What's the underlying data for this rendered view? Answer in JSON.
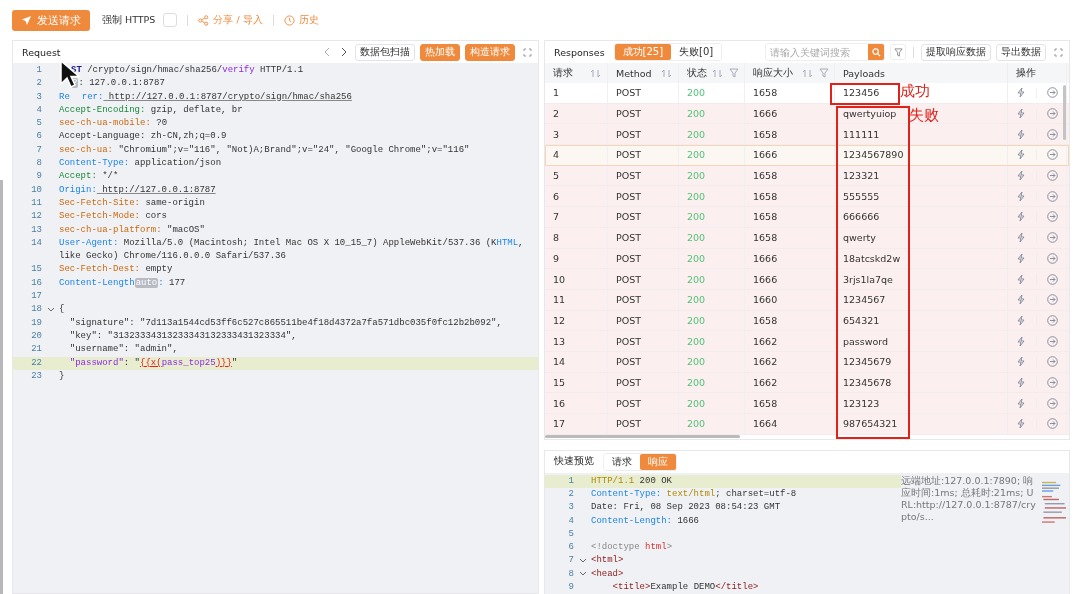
{
  "toolbar": {
    "send_button": "发送请求",
    "force_https": {
      "label": "强制 HTTPS",
      "checked": false
    },
    "share_link": "分享 / 导入",
    "history_link": "历史"
  },
  "request": {
    "title": "Request",
    "buttons": [
      {
        "label": "数据包扫描",
        "primary": false
      },
      {
        "label": "热加载",
        "primary": true
      },
      {
        "label": "构造请求",
        "primary": true
      }
    ],
    "lines": [
      {
        "n": "1",
        "tokens": [
          {
            "t": "ST",
            "kind": "method",
            "covered_before": true
          },
          {
            "t": " /crypto/sign/hmac/sha256/"
          },
          {
            "t": "verify",
            "kind": "purple"
          },
          {
            "t": " HTTP/1.1"
          }
        ]
      },
      {
        "n": "2",
        "tokens": [
          {
            "t": "?",
            "kind": "badge",
            "covered_before": true
          },
          {
            "t": ": 127.0.0.1:8787"
          }
        ]
      },
      {
        "n": "3",
        "tokens": [
          {
            "t": "Re",
            "kind": "blue"
          },
          {
            "t": "rer:",
            "kind": "blue",
            "covered_before": true
          },
          {
            "t": " http://127.0.0.1:8787/crypto/sign/hmac/sha256",
            "kind": "url"
          }
        ]
      },
      {
        "n": "4",
        "tokens": [
          {
            "t": "Accept-Encoding:",
            "kind": "green"
          },
          {
            "t": " gzip, deflate, br"
          }
        ]
      },
      {
        "n": "5",
        "tokens": [
          {
            "t": "sec-ch-ua-mobile:",
            "kind": "orange"
          },
          {
            "t": " ?0"
          }
        ]
      },
      {
        "n": "6",
        "tokens": [
          {
            "t": "Accept-Language: zh-CN,zh;q=0.9"
          }
        ]
      },
      {
        "n": "7",
        "tokens": [
          {
            "t": "sec-ch-ua:",
            "kind": "orange"
          },
          {
            "t": " \"Chromium\";v=\"116\", \"Not)A;Brand\";v=\"24\", \"Google Chrome\";v=\"116\""
          }
        ]
      },
      {
        "n": "8",
        "tokens": [
          {
            "t": "Content-Type:",
            "kind": "blue"
          },
          {
            "t": " application/json"
          }
        ]
      },
      {
        "n": "9",
        "tokens": [
          {
            "t": "Accept:",
            "kind": "green"
          },
          {
            "t": " */*"
          }
        ]
      },
      {
        "n": "10",
        "tokens": [
          {
            "t": "Origin:",
            "kind": "blue"
          },
          {
            "t": " http://127.0.0.1:8787",
            "kind": "url"
          }
        ]
      },
      {
        "n": "11",
        "tokens": [
          {
            "t": "Sec-Fetch-Site:",
            "kind": "orange"
          },
          {
            "t": " same-origin"
          }
        ]
      },
      {
        "n": "12",
        "tokens": [
          {
            "t": "Sec-Fetch-Mode:",
            "kind": "orange"
          },
          {
            "t": " cors"
          }
        ]
      },
      {
        "n": "13",
        "tokens": [
          {
            "t": "sec-ch-ua-platform:",
            "kind": "orange"
          },
          {
            "t": " \"macOS\""
          }
        ]
      },
      {
        "n": "14",
        "tokens": [
          {
            "t": "User-Agent:",
            "kind": "blue"
          },
          {
            "t": " Mozilla/5.0 (Macintosh; Intel Mac OS X 10_15_7) AppleWebKit/537.36 (K"
          },
          {
            "t": "HTML",
            "kind": "blue"
          },
          {
            "t": ","
          }
        ],
        "wrap_tokens": [
          {
            "t": "like Gecko) Chrome/116.0.0.0 Safari/537.36"
          }
        ]
      },
      {
        "n": "15",
        "tokens": [
          {
            "t": "Sec-Fetch-Dest:",
            "kind": "orange"
          },
          {
            "t": " empty"
          }
        ]
      },
      {
        "n": "16",
        "tokens": [
          {
            "t": "Content-Length",
            "kind": "blue"
          },
          {
            "t": "auto",
            "kind": "badge"
          },
          {
            "t": ":",
            "kind": "blue"
          },
          {
            "t": " 177"
          }
        ]
      },
      {
        "n": "17"
      },
      {
        "n": "18",
        "foldable": true,
        "tokens": [
          {
            "t": "{"
          }
        ]
      },
      {
        "n": "19",
        "tokens": [
          {
            "t": "  \"signature\": \"7d113a1544cd53ff6c527c865511be4f18d4372a7fa571dbc035f0fc12b2b092\","
          }
        ]
      },
      {
        "n": "20",
        "tokens": [
          {
            "t": "  \"key\": \"31323334313233343132333431323334\","
          }
        ]
      },
      {
        "n": "21",
        "tokens": [
          {
            "t": "  \"username\": \"admin\","
          }
        ]
      },
      {
        "n": "22",
        "current": true,
        "tokens": [
          {
            "t": "  \"password\"",
            "kind": "purple"
          },
          {
            "t": ": \""
          },
          {
            "t": "{{x(",
            "kind": "red"
          },
          {
            "t": "pass_top25",
            "kind": "purple"
          },
          {
            "t": ")}}",
            "kind": "red"
          },
          {
            "t": "\""
          }
        ]
      },
      {
        "n": "23",
        "tokens": [
          {
            "t": "}"
          }
        ]
      }
    ]
  },
  "responses": {
    "title": "Responses",
    "filters": [
      {
        "label": "成功[25]",
        "selected": true
      },
      {
        "label": "失败[0]",
        "selected": false
      }
    ],
    "search": {
      "placeholder": "请输入关键词搜索"
    },
    "buttons": [
      "提取响应数据",
      "导出数据"
    ],
    "columns": [
      {
        "label": "请求",
        "sortable": true,
        "filterable": false
      },
      {
        "label": "Method",
        "sortable": true,
        "filterable": false
      },
      {
        "label": "状态",
        "sortable": true,
        "filterable": true
      },
      {
        "label": "响应大小",
        "sortable": true,
        "filterable": true
      },
      {
        "label": "Payloads",
        "sortable": false,
        "filterable": false
      },
      {
        "label": "操作",
        "sortable": false,
        "filterable": false
      }
    ],
    "rows": [
      {
        "id": "1",
        "method": "POST",
        "status": "200",
        "size": "1658",
        "payload": "123456",
        "highlighted": false,
        "selected": false
      },
      {
        "id": "2",
        "method": "POST",
        "status": "200",
        "size": "1666",
        "payload": "qwertyuiop",
        "highlighted": true,
        "selected": false
      },
      {
        "id": "3",
        "method": "POST",
        "status": "200",
        "size": "1658",
        "payload": "111111",
        "highlighted": true,
        "selected": false
      },
      {
        "id": "4",
        "method": "POST",
        "status": "200",
        "size": "1666",
        "payload": "1234567890",
        "highlighted": true,
        "selected": true
      },
      {
        "id": "5",
        "method": "POST",
        "status": "200",
        "size": "1658",
        "payload": "123321",
        "highlighted": true,
        "selected": false
      },
      {
        "id": "6",
        "method": "POST",
        "status": "200",
        "size": "1658",
        "payload": "555555",
        "highlighted": true,
        "selected": false
      },
      {
        "id": "7",
        "method": "POST",
        "status": "200",
        "size": "1658",
        "payload": "666666",
        "highlighted": true,
        "selected": false
      },
      {
        "id": "8",
        "method": "POST",
        "status": "200",
        "size": "1658",
        "payload": "qwerty",
        "highlighted": true,
        "selected": false
      },
      {
        "id": "9",
        "method": "POST",
        "status": "200",
        "size": "1666",
        "payload": "18atcskd2w",
        "highlighted": true,
        "selected": false
      },
      {
        "id": "10",
        "method": "POST",
        "status": "200",
        "size": "1666",
        "payload": "3rjs1la7qe",
        "highlighted": true,
        "selected": false
      },
      {
        "id": "11",
        "method": "POST",
        "status": "200",
        "size": "1660",
        "payload": "1234567",
        "highlighted": true,
        "selected": false
      },
      {
        "id": "12",
        "method": "POST",
        "status": "200",
        "size": "1658",
        "payload": "654321",
        "highlighted": true,
        "selected": false
      },
      {
        "id": "13",
        "method": "POST",
        "status": "200",
        "size": "1662",
        "payload": "password",
        "highlighted": true,
        "selected": false
      },
      {
        "id": "14",
        "method": "POST",
        "status": "200",
        "size": "1662",
        "payload": "12345679",
        "highlighted": true,
        "selected": false
      },
      {
        "id": "15",
        "method": "POST",
        "status": "200",
        "size": "1662",
        "payload": "12345678",
        "highlighted": true,
        "selected": false
      },
      {
        "id": "16",
        "method": "POST",
        "status": "200",
        "size": "1658",
        "payload": "123123",
        "highlighted": true,
        "selected": false
      },
      {
        "id": "17",
        "method": "POST",
        "status": "200",
        "size": "1664",
        "payload": "987654321",
        "highlighted": true,
        "selected": false
      }
    ],
    "annotations": [
      {
        "label": "成功"
      },
      {
        "label": "失败"
      }
    ]
  },
  "preview": {
    "title": "快速预览",
    "tabs": [
      {
        "label": "请求",
        "selected": false
      },
      {
        "label": "响应",
        "selected": true
      }
    ],
    "info": "远端地址:127.0.0.1:7890; 响应时间:1ms; 总耗时:21ms; URL:http://127.0.0.1:8787/crypto/s...",
    "lines": [
      {
        "n": "1",
        "current": true,
        "tokens": [
          {
            "t": "HTTP/1.1",
            "kind": "gold"
          },
          {
            "t": " 200 OK"
          }
        ]
      },
      {
        "n": "2",
        "tokens": [
          {
            "t": "Content-Type:",
            "kind": "blue"
          },
          {
            "t": " text/html",
            "kind": "gold"
          },
          {
            "t": "; charset=utf-8"
          }
        ]
      },
      {
        "n": "3",
        "tokens": [
          {
            "t": "Date: Fri, 08 Sep 2023 08:54:23 GMT"
          }
        ]
      },
      {
        "n": "4",
        "tokens": [
          {
            "t": "Content-Length:",
            "kind": "blue"
          },
          {
            "t": " 1666"
          }
        ]
      },
      {
        "n": "5"
      },
      {
        "n": "6",
        "tokens": [
          {
            "t": "<!doctype ",
            "kind": "gray"
          },
          {
            "t": "html",
            "kind": "tagred"
          },
          {
            "t": ">",
            "kind": "gray"
          }
        ]
      },
      {
        "n": "7",
        "foldable": true,
        "tokens": [
          {
            "t": "<html>",
            "kind": "tag"
          }
        ]
      },
      {
        "n": "8",
        "foldable": true,
        "tokens": [
          {
            "t": "<head>",
            "kind": "tag"
          }
        ]
      },
      {
        "n": "9",
        "tokens": [
          {
            "t": "    <title>",
            "kind": "tag"
          },
          {
            "t": "Example DEMO"
          },
          {
            "t": "</title>",
            "kind": "tag"
          }
        ]
      }
    ]
  }
}
